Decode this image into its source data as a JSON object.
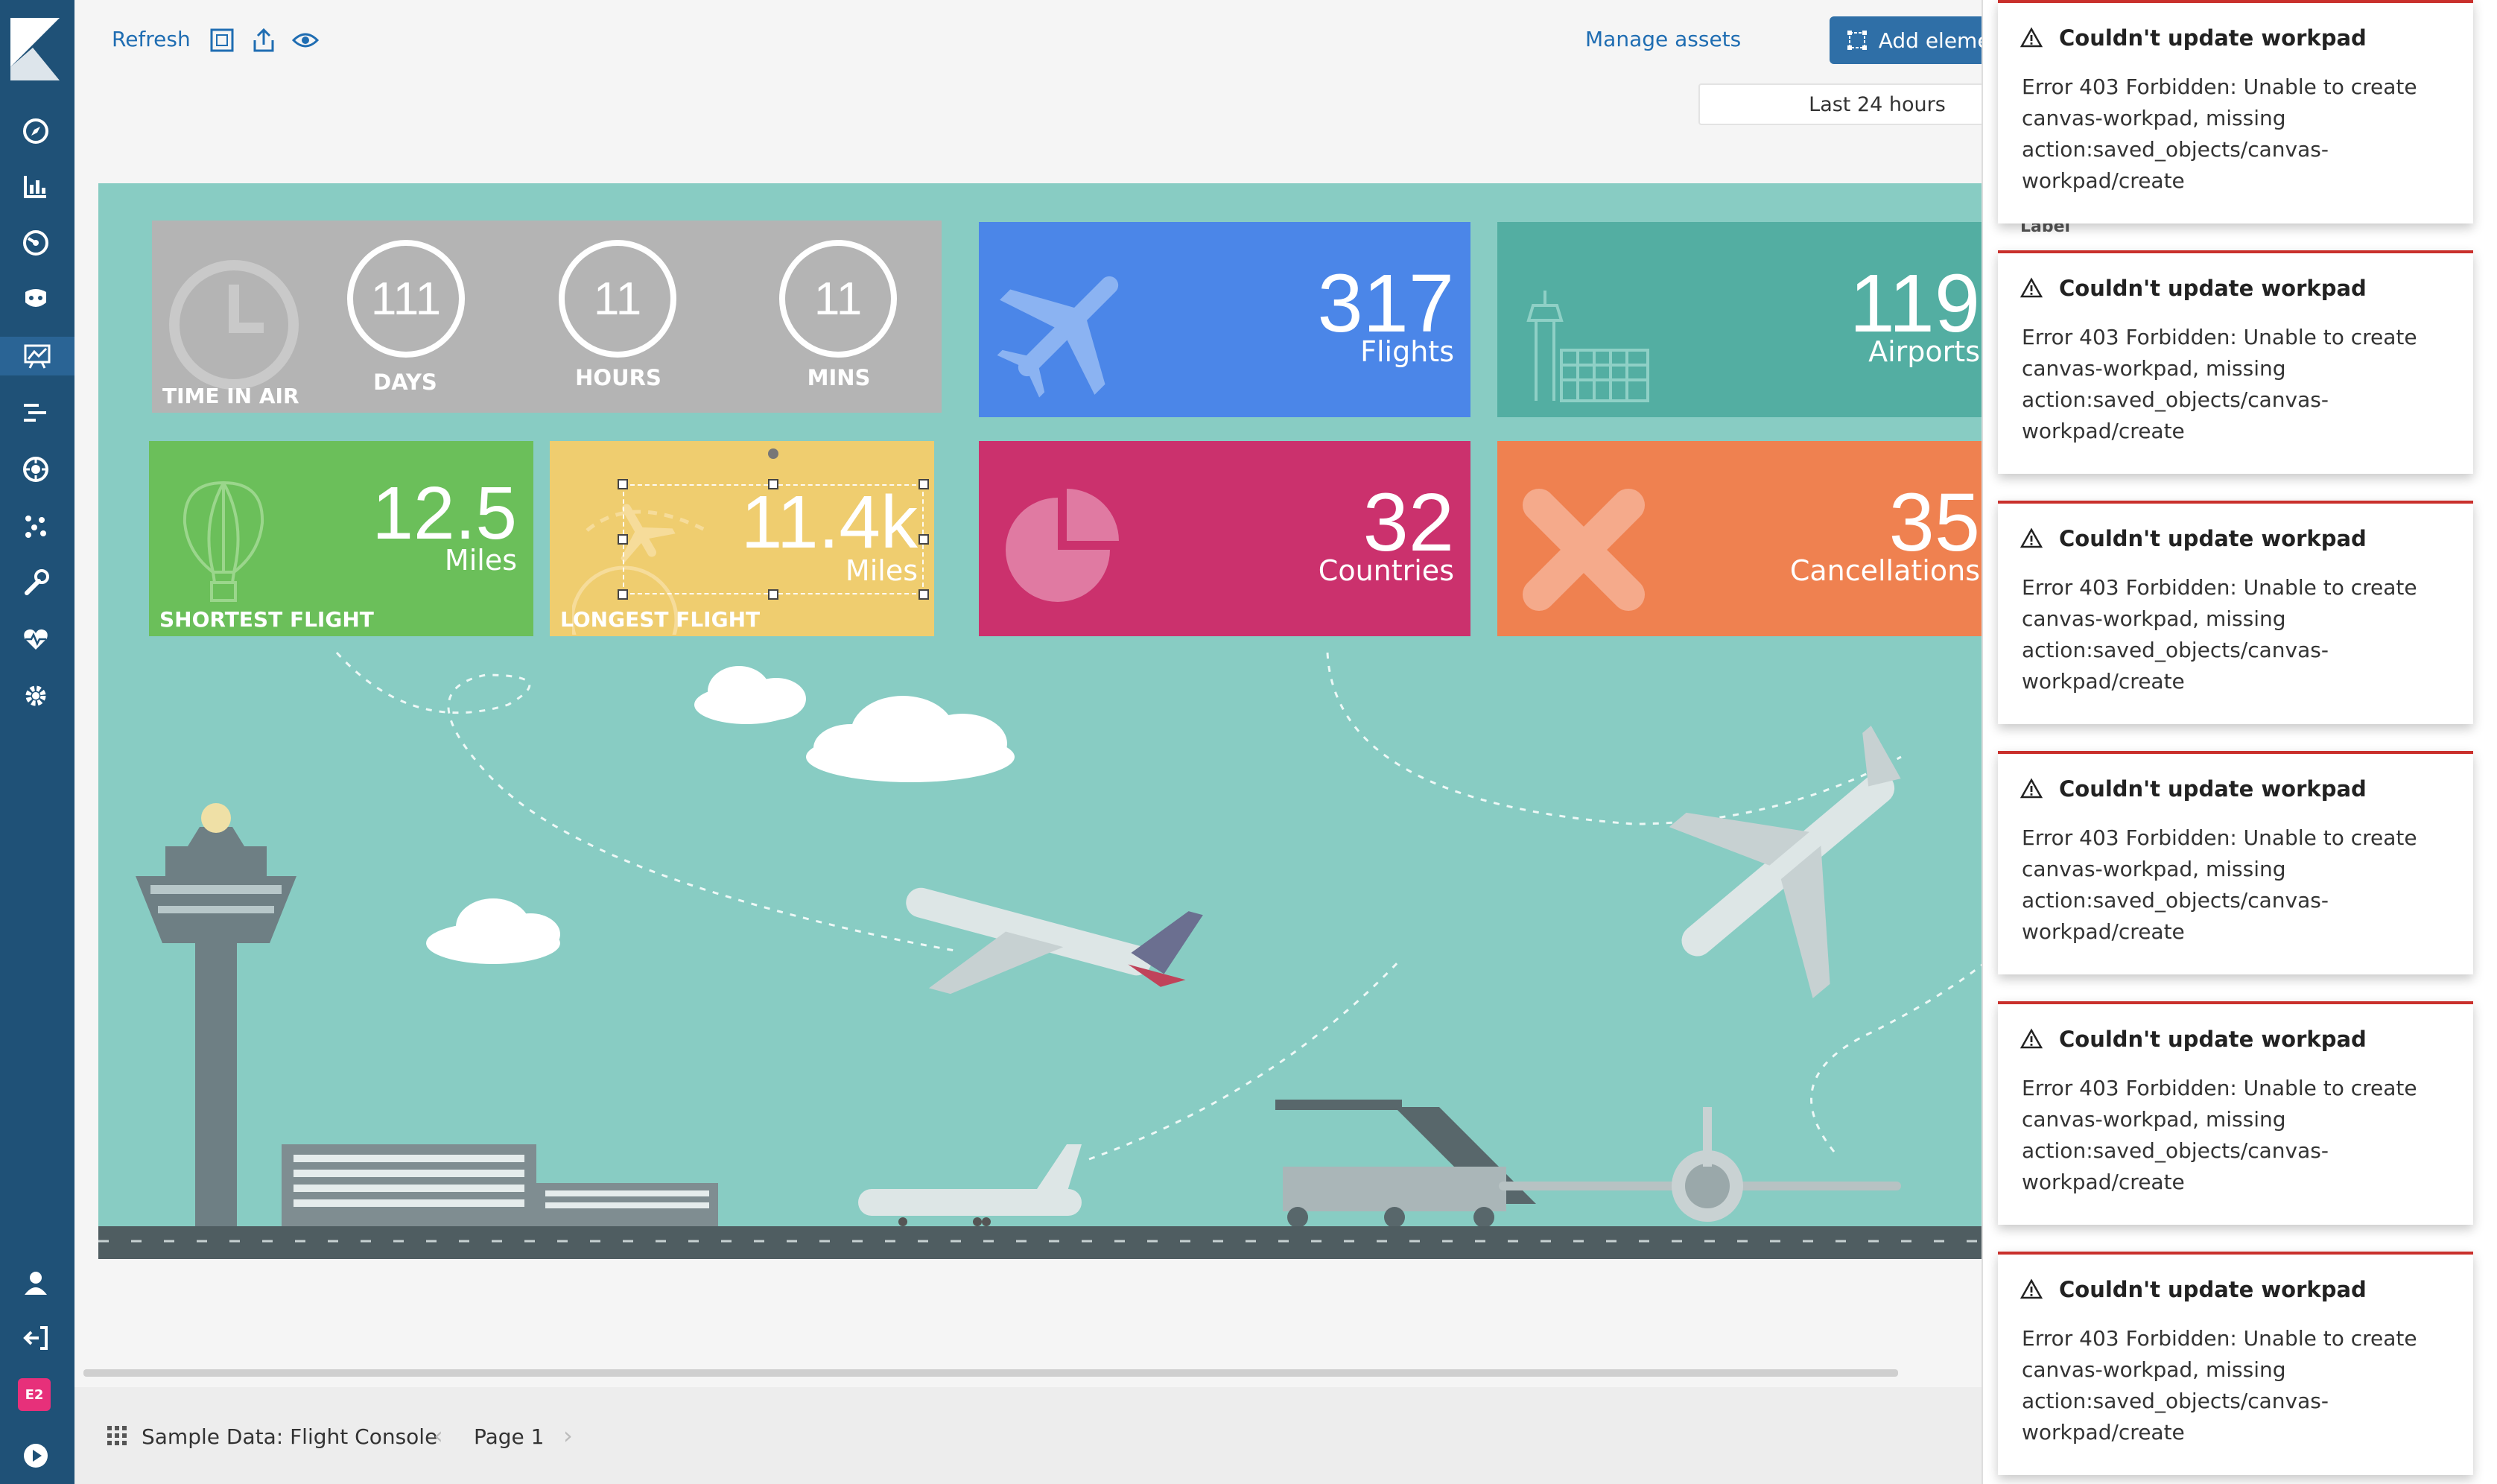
{
  "sidebar": {
    "nav_icons": [
      "discover-icon",
      "visualize-icon",
      "dashboard-icon",
      "timelion-icon",
      "canvas-icon",
      "apm-icon",
      "infrastructure-icon",
      "ml-icon",
      "dev-tools-icon",
      "monitoring-icon",
      "management-icon"
    ],
    "bottom_icons": [
      "user-icon",
      "logout-icon"
    ],
    "space_badge": "E2"
  },
  "toolbar": {
    "refresh_label": "Refresh",
    "manage_assets_label": "Manage assets",
    "add_element_label": "Add element",
    "time_range_label": "Last 24 hours"
  },
  "workpad": {
    "time_in_air": {
      "days_value": "111",
      "days_label": "DAYS",
      "hours_value": "11",
      "hours_label": "HOURS",
      "mins_value": "11",
      "mins_label": "MINS",
      "caption": "TIME IN AIR"
    },
    "flights": {
      "value": "317",
      "label": "Flights"
    },
    "airports": {
      "value": "119",
      "label": "Airports"
    },
    "shortest": {
      "value": "12.5",
      "unit": "Miles",
      "caption": "SHORTEST FLIGHT"
    },
    "longest": {
      "value": "11.4k",
      "unit": "Miles",
      "caption": "LONGEST FLIGHT"
    },
    "countries": {
      "value": "32",
      "label": "Countries"
    },
    "cancellations": {
      "value": "35",
      "label": "Cancellations"
    }
  },
  "side_panel": {
    "ghost_label": "Label"
  },
  "footer": {
    "workpad_name": "Sample Data: Flight Console",
    "page_label": "Page 1"
  },
  "toasts": [
    {
      "title": "Couldn't update workpad",
      "body": "Error 403 Forbidden: Unable to create canvas-workpad, missing action:saved_objects/canvas-workpad/create"
    },
    {
      "title": "Couldn't update workpad",
      "body": "Error 403 Forbidden: Unable to create canvas-workpad, missing action:saved_objects/canvas-workpad/create"
    },
    {
      "title": "Couldn't update workpad",
      "body": "Error 403 Forbidden: Unable to create canvas-workpad, missing action:saved_objects/canvas-workpad/create"
    },
    {
      "title": "Couldn't update workpad",
      "body": "Error 403 Forbidden: Unable to create canvas-workpad, missing action:saved_objects/canvas-workpad/create"
    },
    {
      "title": "Couldn't update workpad",
      "body": "Error 403 Forbidden: Unable to create canvas-workpad, missing action:saved_objects/canvas-workpad/create"
    },
    {
      "title": "Couldn't update workpad",
      "body": "Error 403 Forbidden: Unable to create canvas-workpad, missing action:saved_objects/canvas-workpad/create"
    }
  ],
  "colors": {
    "sidebar": "#1f5177",
    "canvas_bg": "#88ccc3",
    "flights": "#4b86e8",
    "airports": "#53aea2",
    "shortest": "#6bbf5a",
    "longest": "#efcd6f",
    "countries": "#cb316d",
    "cancellations": "#ef8150",
    "error": "#c9302c"
  }
}
